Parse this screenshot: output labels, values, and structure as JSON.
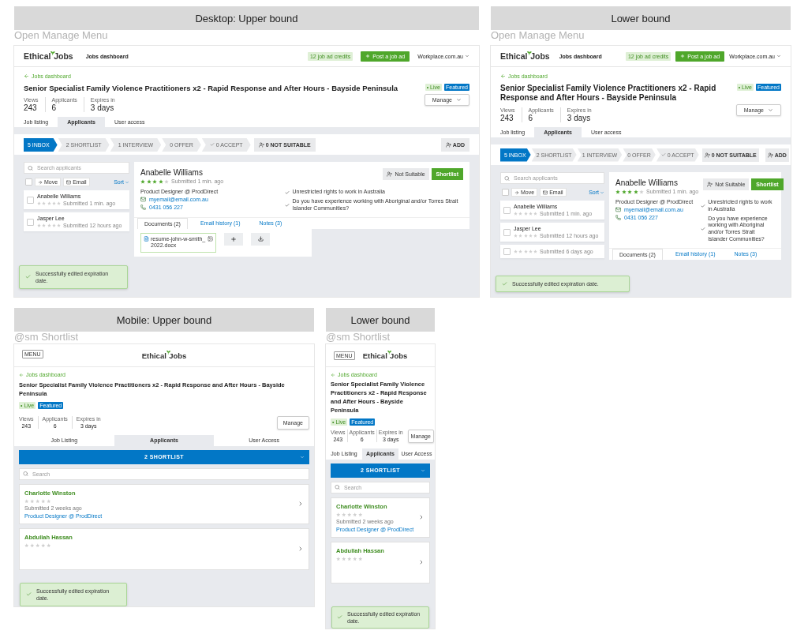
{
  "artboards": [
    {
      "kind": "desktop_wide",
      "heading": "Desktop: Upper bound",
      "label": "Open Manage Menu",
      "screen": {
        "logo": {
          "part_1": "Ethical",
          "part_2": "Jobs"
        },
        "nav_link": "Jobs dashboard",
        "credits": "12 job ad credits",
        "post_button": "Post a job ad",
        "account": "Workplace.com.au",
        "back_link": "Jobs dashboard",
        "title": "Senior Specialist Family Violence Practitioners x2 - Rapid Response and After Hours - Bayside Peninsula",
        "badges": [
          {
            "label": "• Live",
            "kind": "live"
          },
          {
            "label": "Featured",
            "kind": "featured"
          }
        ],
        "stats": [
          {
            "label": "Views",
            "value": "243"
          },
          {
            "label": "Applicants",
            "value": "6"
          },
          {
            "label": "Expires in",
            "value": "3 days"
          }
        ],
        "manage_button": "Manage",
        "tabs": [
          {
            "label": "Job listing",
            "selected": false
          },
          {
            "label": "Applicants",
            "selected": true
          },
          {
            "label": "User access",
            "selected": false
          }
        ],
        "stages": [
          {
            "label": "5 INBOX",
            "selected": true,
            "kind": "step"
          },
          {
            "label": "2 SHORTLIST",
            "selected": false,
            "kind": "step"
          },
          {
            "label": "1 INTERVIEW",
            "selected": false,
            "kind": "step"
          },
          {
            "label": "0 OFFER",
            "selected": false,
            "kind": "step"
          },
          {
            "label": "0 ACCEPT",
            "selected": false,
            "kind": "check_step"
          }
        ],
        "reject_stage": "0 NOT SUITABLE",
        "add_button": "ADD",
        "search_placeholder": "Search applicants",
        "select_all_checked": false,
        "move_button": "Move",
        "email_button": "Email",
        "sort": "Sort",
        "applicants": [
          {
            "name": "Anabelle Williams",
            "stars": 0,
            "submitted": "Submitted 1 min. ago",
            "checked": false
          },
          {
            "name": "Jasper Lee",
            "stars": 0,
            "submitted": "Submitted 12 hours ago",
            "checked": false
          }
        ],
        "detail": {
          "name": "Anabelle Williams",
          "stars": 4,
          "submitted": "Submitted 1 min. ago",
          "not_suitable_button": "Not Suitable",
          "shortlist_button": "Shortlist",
          "role": "Product Designer @ ProdDirect",
          "email": "myemail@email.com.au",
          "phone": "0431 056 227",
          "answers": [
            "Unrestricted rights to work in Australia",
            "Do you have experience working with Aboriginal and/or Torres Strait Islander Communities?"
          ],
          "doc_tabs": [
            {
              "label": "Documents (2)",
              "selected": true
            },
            {
              "label": "Email history (1)",
              "selected": false
            },
            {
              "label": "Notes (3)",
              "selected": false
            }
          ],
          "documents": [
            {
              "file": "resume-john-w-smith_2022.docx"
            }
          ]
        },
        "toast": "Successfully edited expiration date."
      }
    },
    {
      "kind": "desktop_narrow",
      "heading": "Lower bound",
      "label": "Open Manage Menu",
      "screen": {
        "logo": {
          "part_1": "Ethical",
          "part_2": "Jobs"
        },
        "nav_link": "Jobs dashboard",
        "credits": "12 job ad credits",
        "post_button": "Post a job ad",
        "account": "Workplace.com.au",
        "back_link": "Jobs dashboard",
        "title": "Senior Specialist Family Violence Practitioners x2 - Rapid Response and After Hours - Bayside Peninsula",
        "badges": [
          {
            "label": "• Live",
            "kind": "live"
          },
          {
            "label": "Featured",
            "kind": "featured"
          }
        ],
        "stats": [
          {
            "label": "Views",
            "value": "243"
          },
          {
            "label": "Applicants",
            "value": "6"
          },
          {
            "label": "Expires in",
            "value": "3 days"
          }
        ],
        "manage_button": "Manage",
        "tabs": [
          {
            "label": "Job listing",
            "selected": false
          },
          {
            "label": "Applicants",
            "selected": true
          },
          {
            "label": "User access",
            "selected": false
          }
        ],
        "stages": [
          {
            "label": "5 INBOX",
            "selected": true,
            "kind": "step"
          },
          {
            "label": "2 SHORTLIST",
            "selected": false,
            "kind": "step"
          },
          {
            "label": "1 INTERVIEW",
            "selected": false,
            "kind": "step"
          },
          {
            "label": "0 OFFER",
            "selected": false,
            "kind": "step"
          },
          {
            "label": "0 ACCEPT",
            "selected": false,
            "kind": "check_step"
          }
        ],
        "reject_stage": "0 NOT SUITABLE",
        "add_button": "ADD",
        "search_placeholder": "Search applicants",
        "select_all_checked": false,
        "move_button": "Move",
        "email_button": "Email",
        "sort": "Sort",
        "applicants": [
          {
            "name": "Anabelle Williams",
            "stars": 0,
            "submitted": "Submitted 1 min. ago",
            "checked": false
          },
          {
            "name": "Jasper Lee",
            "stars": 0,
            "submitted": "Submitted 12 hours ago",
            "checked": false
          },
          {
            "stars": 0,
            "submitted": "Submitted 6 days ago",
            "checked": false
          }
        ],
        "detail": {
          "name": "Anabelle Williams",
          "stars": 4,
          "submitted": "Submitted 1 min. ago",
          "not_suitable_button": "Not Suitable",
          "shortlist_button": "Shortlist",
          "role": "Product Designer @ ProdDirect",
          "email": "myemail@email.com.au",
          "phone": "0431 056 227",
          "answers": [
            "Unrestricted rights to work in Australia",
            "Do you have experience working with Aboriginal and/or Torres Strait Islander Communities?"
          ],
          "doc_tabs": [
            {
              "label": "Documents (2)",
              "selected": true
            },
            {
              "label": "Email history (1)",
              "selected": false
            },
            {
              "label": "Notes (3)",
              "selected": false
            }
          ]
        },
        "toast": "Successfully edited expiration date."
      }
    },
    {
      "kind": "mobile_wide",
      "heading": "Mobile: Upper bound",
      "label": "@sm Shortlist",
      "screen": {
        "menu_button": "MENU",
        "logo": {
          "part_1": "Ethical",
          "part_2": "Jobs"
        },
        "back_link": "Jobs dashboard",
        "title": "Senior Specialist Family Violence Practitioners x2 - Rapid Response and After Hours - Bayside Peninsula",
        "badges": [
          {
            "label": "• Live",
            "kind": "live"
          },
          {
            "label": "Featured",
            "kind": "featured"
          }
        ],
        "stats": [
          {
            "label": "Views",
            "value": "243"
          },
          {
            "label": "Applicants",
            "value": "6"
          },
          {
            "label": "Expires in",
            "value": "3 days"
          }
        ],
        "manage_button": "Manage",
        "tabs": [
          {
            "label": "Job Listing",
            "selected": false
          },
          {
            "label": "Applicants",
            "selected": true
          },
          {
            "label": "User Access",
            "selected": false
          }
        ],
        "stage_select": "2 SHORTLIST",
        "search_placeholder": "Search",
        "cards": [
          {
            "name": "Charlotte Winston",
            "stars": 0,
            "submitted": "Submitted 2 weeks ago",
            "role": "Product Designer @ ProdDirect"
          },
          {
            "name": "Abdullah Hassan",
            "stars": 0
          }
        ],
        "toast": "Successfully edited expiration date."
      }
    },
    {
      "kind": "mobile_narrow",
      "heading": "Lower bound",
      "label": "@sm Shortlist",
      "screen": {
        "menu_button": "MENU",
        "logo": {
          "part_1": "Ethical",
          "part_2": "Jobs"
        },
        "back_link": "Jobs dashboard",
        "title": "Senior Specialist Family Violence Practitioners x2 - Rapid Response and After Hours - Bayside Peninsula",
        "badges": [
          {
            "label": "• Live",
            "kind": "live"
          },
          {
            "label": "Featured",
            "kind": "featured"
          }
        ],
        "stats": [
          {
            "label": "Views",
            "value": "243"
          },
          {
            "label": "Applicants",
            "value": "6"
          },
          {
            "label": "Expires in",
            "value": "3 days"
          }
        ],
        "manage_button": "Manage",
        "tabs": [
          {
            "label": "Job Listing",
            "selected": false
          },
          {
            "label": "Applicants",
            "selected": true
          },
          {
            "label": "User Access",
            "selected": false
          }
        ],
        "stage_select": "2 SHORTLIST",
        "search_placeholder": "Search",
        "cards": [
          {
            "name": "Charlotte Winston",
            "stars": 0,
            "submitted": "Submitted 2 weeks ago",
            "role": "Product Designer @ ProdDirect"
          },
          {
            "name": "Abdullah Hassan",
            "stars": 0
          }
        ],
        "toast": "Successfully edited expiration date."
      }
    }
  ]
}
